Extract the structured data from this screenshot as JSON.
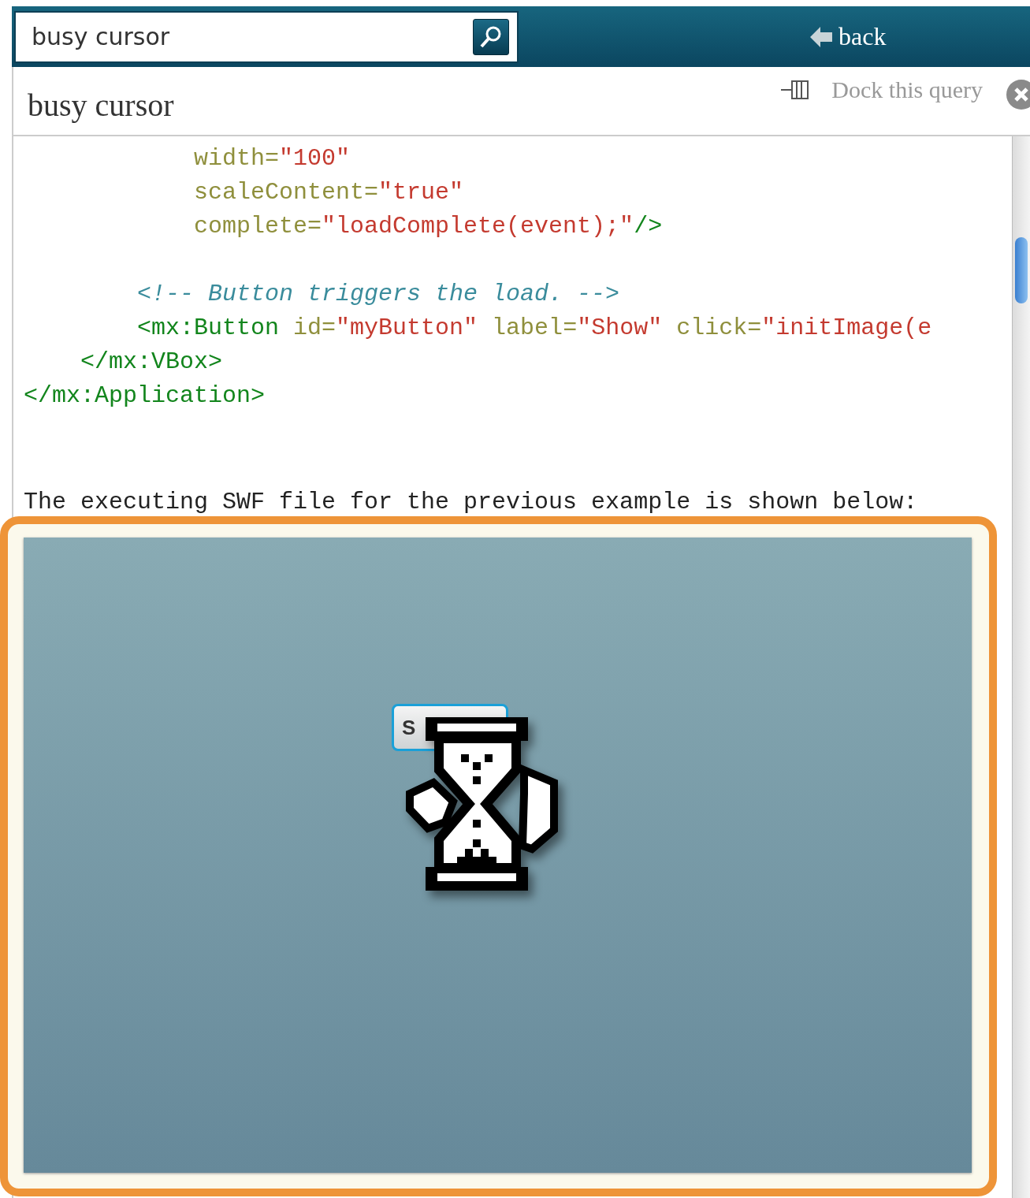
{
  "search": {
    "value": "busy cursor"
  },
  "nav": {
    "back_label": "back"
  },
  "query": {
    "title": "busy cursor",
    "dock_label": "Dock this query"
  },
  "code": {
    "blocks": [
      [
        {
          "tokens": [
            {
              "kind": "attr",
              "text": "            width="
            },
            {
              "kind": "value",
              "text": "\"100\""
            }
          ]
        },
        {
          "tokens": [
            {
              "kind": "attr",
              "text": "            scaleContent="
            },
            {
              "kind": "value",
              "text": "\"true\""
            }
          ]
        },
        {
          "tokens": [
            {
              "kind": "attr",
              "text": "            complete="
            },
            {
              "kind": "value",
              "text": "\"loadComplete(event);\""
            },
            {
              "kind": "tag",
              "text": "/>"
            }
          ]
        }
      ],
      [
        {
          "tokens": [
            {
              "kind": "comment",
              "text": "        <!-- Button triggers the load. -->"
            }
          ]
        },
        {
          "tokens": [
            {
              "kind": "tag",
              "text": "        <mx:Button"
            },
            {
              "kind": "attr",
              "text": " id="
            },
            {
              "kind": "value",
              "text": "\"myButton\""
            },
            {
              "kind": "attr",
              "text": " label="
            },
            {
              "kind": "value",
              "text": "\"Show\""
            },
            {
              "kind": "attr",
              "text": " click="
            },
            {
              "kind": "value",
              "text": "\"initImage(e"
            }
          ]
        },
        {
          "tokens": [
            {
              "kind": "tag",
              "text": "    </mx:VBox>"
            }
          ]
        },
        {
          "tokens": [
            {
              "kind": "tag",
              "text": "</mx:Application>"
            }
          ]
        }
      ]
    ]
  },
  "caption": "The executing SWF file for the previous example is shown below:",
  "swf": {
    "button_label": "S",
    "busy": true
  }
}
